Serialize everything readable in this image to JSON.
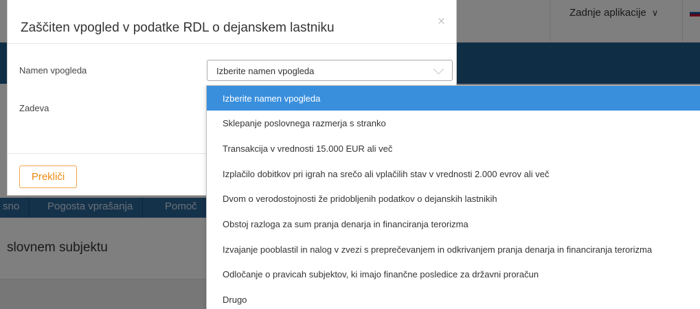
{
  "background": {
    "recent_apps_label": "Zadnje aplikacije",
    "nav_items": [
      "sno",
      "Pogosta vprašanja",
      "Pomoč"
    ],
    "subject_title": "slovnem subjektu",
    "colors": {
      "banner": "#1e5d8c",
      "nav": "#2a6496"
    }
  },
  "modal": {
    "title": "Zaščiten vpogled v podatke RDL o dejanskem lastniku",
    "close_icon": "×",
    "fields": {
      "purpose_label": "Namen vpogleda",
      "case_label": "Zadeva"
    },
    "select": {
      "value": "Izberite namen vpogleda"
    },
    "footer": {
      "cancel_label": "Prekliči"
    }
  },
  "dropdown": {
    "selected_index": 0,
    "options": [
      "Izberite namen vpogleda",
      "Sklepanje poslovnega razmerja s stranko",
      "Transakcija v vrednosti 15.000 EUR ali več",
      "Izplačilo dobitkov pri igrah na srečo ali vplačilih stav v vrednosti 2.000 evrov ali več",
      "Dvom o verodostojnosti že pridobljenih podatkov o dejanskih lastnikih",
      "Obstoj razloga za sum pranja denarja in financiranja terorizma",
      "Izvajanje pooblastil in nalog v zvezi s preprečevanjem in odkrivanjem pranja denarja in financiranja terorizma",
      "Odločanje o pravicah subjektov, ki imajo finančne posledice za državni proračun",
      "Drugo"
    ],
    "colors": {
      "highlight": "#3a8fdd"
    }
  },
  "colors": {
    "accent_orange": "#ef8a10"
  }
}
